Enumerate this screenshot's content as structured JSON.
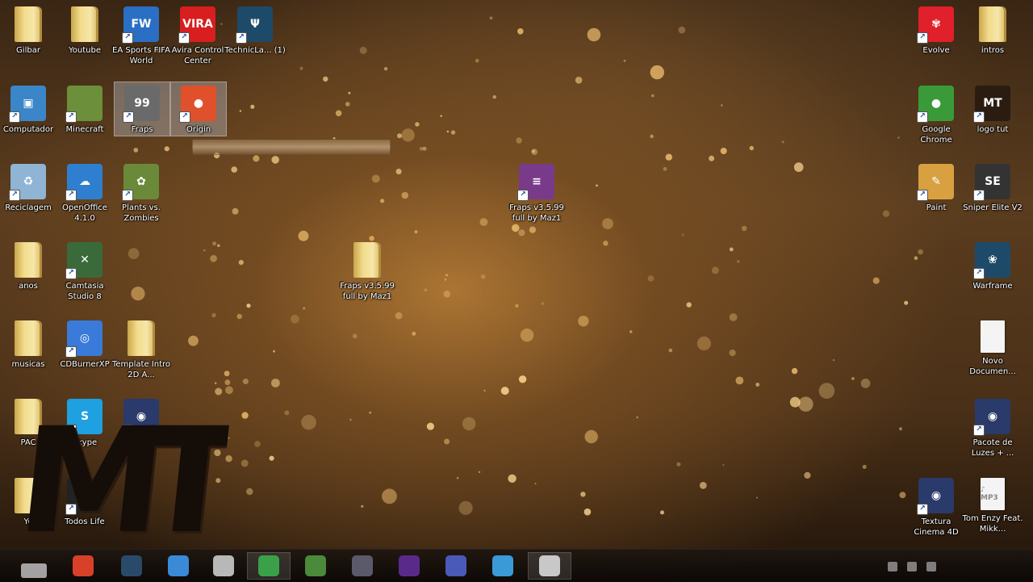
{
  "desktop_icons": [
    {
      "id": "gilbar",
      "label": "Gilbar",
      "kind": "folder-user",
      "color": "#e2c15e",
      "selected": false
    },
    {
      "id": "youtube",
      "label": "Youtube",
      "kind": "folder",
      "color": "#e2c15e",
      "selected": false
    },
    {
      "id": "ea-fifa",
      "label": "EA Sports FIFA World",
      "kind": "app",
      "text": "FW",
      "color": "#2a6fc4",
      "selected": false
    },
    {
      "id": "avira",
      "label": "Avira Control Center",
      "kind": "app",
      "text": "VIRA",
      "color": "#d81e1e",
      "selected": false
    },
    {
      "id": "technic",
      "label": "TechnicLa... (1)",
      "kind": "app",
      "text": "Ψ",
      "color": "#1e4a6a",
      "selected": false
    },
    {
      "id": "computador",
      "label": "Computador",
      "kind": "app",
      "text": "▣",
      "color": "#3b86c8",
      "selected": false
    },
    {
      "id": "minecraft",
      "label": "Minecraft",
      "kind": "app",
      "text": "",
      "color": "#6b8f3a",
      "selected": false
    },
    {
      "id": "fraps",
      "label": "Fraps",
      "kind": "app",
      "text": "99",
      "color": "#6a6a6a",
      "selected": true
    },
    {
      "id": "origin",
      "label": "Origin",
      "kind": "app",
      "text": "●",
      "color": "#e0502a",
      "selected": true
    },
    {
      "id": "lixeira",
      "label": "Reciclagem",
      "kind": "app",
      "text": "♻",
      "color": "#8fb4d4",
      "selected": false
    },
    {
      "id": "openoffice",
      "label": "OpenOffice 4.1.0",
      "kind": "app",
      "text": "☁",
      "color": "#2f7fd1",
      "selected": false
    },
    {
      "id": "plants",
      "label": "Plants vs. Zombies",
      "kind": "app",
      "text": "✿",
      "color": "#6a8a3a",
      "selected": false
    },
    {
      "id": "winrar",
      "label": "Fraps v3.5.99 full by Maz1",
      "kind": "app",
      "text": "≡",
      "color": "#7a3a8a",
      "selected": false
    },
    {
      "id": "anos",
      "label": "anos",
      "kind": "folder",
      "color": "#e2c15e",
      "selected": false
    },
    {
      "id": "camtasia",
      "label": "Camtasia Studio 8",
      "kind": "app",
      "text": "✕",
      "color": "#3a6a3a",
      "selected": false
    },
    {
      "id": "fraps-folder",
      "label": "Fraps v3.5.99 full by Maz1",
      "kind": "folder",
      "color": "#e2c15e",
      "selected": false
    },
    {
      "id": "musicas",
      "label": "musicas",
      "kind": "folder",
      "color": "#e2c15e",
      "selected": false
    },
    {
      "id": "cdburner",
      "label": "CDBurnerXP",
      "kind": "app",
      "text": "◎",
      "color": "#3a7ad8",
      "selected": false
    },
    {
      "id": "template",
      "label": "Template Intro 2D A...",
      "kind": "folder",
      "color": "#e2c15e",
      "selected": false
    },
    {
      "id": "pac",
      "label": "PAC",
      "kind": "folder",
      "color": "#e2c15e",
      "selected": false
    },
    {
      "id": "skype",
      "label": "Skype",
      "kind": "app",
      "text": "S",
      "color": "#1fa0e0",
      "selected": false
    },
    {
      "id": "cinema4d-left",
      "label": "",
      "kind": "app",
      "text": "◉",
      "color": "#2a3a6a",
      "selected": false
    },
    {
      "id": "you-partial",
      "label": "Yo",
      "kind": "folder",
      "color": "#e2c15e",
      "selected": false
    },
    {
      "id": "todos-life",
      "label": "Todos Life",
      "kind": "app",
      "text": "",
      "color": "#222222",
      "selected": false
    },
    {
      "id": "evolve",
      "label": "Evolve",
      "kind": "app",
      "text": "✾",
      "color": "#e0202a",
      "selected": false
    },
    {
      "id": "intros",
      "label": "intros",
      "kind": "folder",
      "color": "#e2c15e",
      "selected": false
    },
    {
      "id": "chrome",
      "label": "Google Chrome",
      "kind": "app",
      "text": "●",
      "color": "#3a9a3a",
      "selected": false
    },
    {
      "id": "logo-tut",
      "label": "logo tut",
      "kind": "app",
      "text": "MT",
      "color": "#2a1c10",
      "selected": false
    },
    {
      "id": "paint",
      "label": "Paint",
      "kind": "app",
      "text": "✎",
      "color": "#d8a040",
      "selected": false
    },
    {
      "id": "sniper",
      "label": "Sniper Elite V2",
      "kind": "app",
      "text": "SE",
      "color": "#333333",
      "selected": false
    },
    {
      "id": "warframe",
      "label": "Warframe",
      "kind": "app",
      "text": "❀",
      "color": "#1e4a6a",
      "selected": false
    },
    {
      "id": "novo-doc",
      "label": "Novo Documen...",
      "kind": "doc",
      "text": "",
      "color": "#f4f4f4",
      "selected": false
    },
    {
      "id": "pacote-luzes",
      "label": "Pacote de Luzes + ...",
      "kind": "app",
      "text": "◉",
      "color": "#2a3a6a",
      "selected": false
    },
    {
      "id": "textura-c4d",
      "label": "Textura Cinema 4D",
      "kind": "app",
      "text": "◉",
      "color": "#2a3a6a",
      "selected": false
    },
    {
      "id": "tom-enzy",
      "label": "Tom Enzy Feat. Mikk...",
      "kind": "doc",
      "text": "♪ MP3",
      "color": "#f4f4f4",
      "selected": false
    }
  ],
  "watermark_text": "MT",
  "taskbar": {
    "buttons": [
      {
        "id": "tb-origin",
        "color": "#d8402a",
        "active": false
      },
      {
        "id": "tb-cmd",
        "color": "#2a4a6a",
        "active": false
      },
      {
        "id": "tb-explorer",
        "color": "#3a8ad8",
        "active": false
      },
      {
        "id": "tb-app",
        "color": "#b8b8b8",
        "active": false
      },
      {
        "id": "tb-chrome",
        "color": "#3aa04a",
        "active": true
      },
      {
        "id": "tb-minecraft",
        "color": "#4a8a3a",
        "active": false
      },
      {
        "id": "tb-steam",
        "color": "#5a5a6a",
        "active": false
      },
      {
        "id": "tb-premiere",
        "color": "#5a2a8a",
        "active": false
      },
      {
        "id": "tb-discord",
        "color": "#4a5ab8",
        "active": false
      },
      {
        "id": "tb-paint",
        "color": "#3a9ad8",
        "active": false
      },
      {
        "id": "tb-camtasia",
        "color": "#c8c8c8",
        "active": true
      }
    ],
    "clock_time": "",
    "clock_date": ""
  }
}
